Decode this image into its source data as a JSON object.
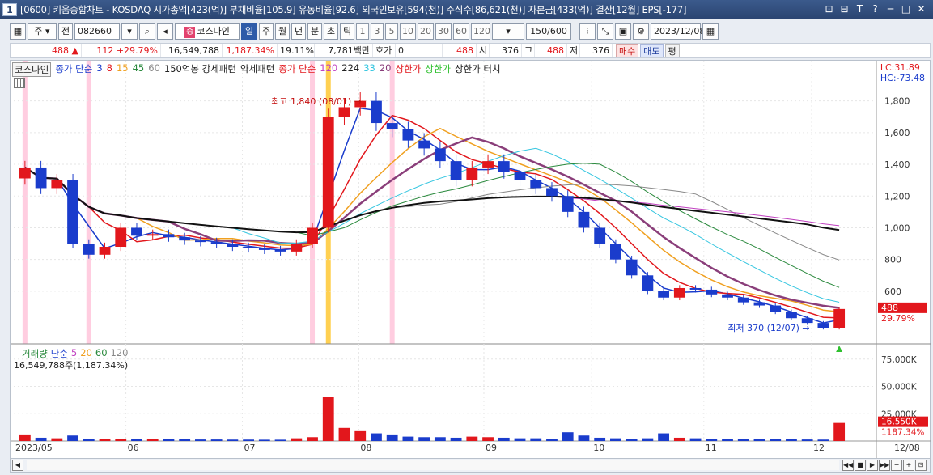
{
  "window": {
    "num": "1",
    "title": "[0600] 키움종합차트 - KOSDAQ 시가총액[423(억)] 부채비율[105.9] 유동비율[92.6] 외국인보유[594(천)] 주식수[86,621(천)] 자본금[433(억)] 결산[12월] EPS[-177]",
    "buttons": [
      "⊡",
      "⊟",
      "T",
      "?",
      "─",
      "□",
      "✕"
    ]
  },
  "toolbar": {
    "period": "주",
    "prev": "전",
    "code": "082660",
    "stock_badge": "증",
    "stock_name": "코스나인",
    "tabs": [
      "일",
      "주",
      "월",
      "년",
      "분",
      "초",
      "틱"
    ],
    "selected_tab": "일",
    "nums": [
      "1",
      "3",
      "5",
      "10",
      "20",
      "30",
      "60",
      "120"
    ],
    "count": "150/600",
    "date": "2023/12/08"
  },
  "info": {
    "price": "488",
    "change": "112",
    "change_pct": "+29.79%",
    "volume": "16,549,788",
    "volume_pct": "1,187.34%",
    "turnover": "19.11%",
    "amount": "7,781백만",
    "hoga_label": "호가",
    "hoga": "0",
    "p1": "488",
    "open_label": "시",
    "open": "376",
    "high_label": "고",
    "high": "488",
    "low_label": "저",
    "low": "376",
    "buy": "매수",
    "sell": "매도",
    "flat": "평"
  },
  "chart": {
    "legend": {
      "name": "코스나인",
      "ma_label": "종가 단순",
      "ma_periods": [
        "3",
        "8",
        "15",
        "45",
        "60"
      ],
      "pattern1": "150억봉 강세패턴",
      "pattern2": "약세패턴",
      "ma2_label": "종가 단순",
      "ma2_periods": [
        "120",
        "224",
        "33",
        "20"
      ],
      "limit_up": "상한가",
      "limit_up2": "상한가",
      "limit_touch": "상한가 터치"
    },
    "lc": "LC:31.89",
    "hc": "HC:-73.48",
    "max_label": "최고 1,840 (08/01)",
    "min_label": "최저 370 (12/07)",
    "price_tag": "488",
    "pct_tag": "29.79%",
    "vol_legend": {
      "label": "거래량",
      "ma_label": "단순",
      "periods": [
        "5",
        "20",
        "60",
        "120"
      ]
    },
    "vol_info": "16,549,788주(1,187.34%)",
    "vol_tag": "16,550K",
    "vol_pct_tag": "1187.34%",
    "x_months": [
      "2023/05",
      "06",
      "07",
      "08",
      "09",
      "10",
      "11",
      "12",
      "12/08"
    ]
  },
  "chart_data": {
    "type": "candlestick",
    "price_axis": {
      "ticks": [
        "1,800",
        "1,600",
        "1,400",
        "1,200",
        "1,000",
        "800",
        "600"
      ],
      "ylim": [
        370,
        1900
      ]
    },
    "volume_axis": {
      "ticks": [
        "75,000K",
        "50,000K",
        "25,000K"
      ],
      "ylim": [
        0,
        80000
      ]
    },
    "series": [
      {
        "name": "close",
        "values": [
          1380,
          1250,
          1300,
          900,
          830,
          880,
          1000,
          950,
          960,
          940,
          920,
          910,
          900,
          880,
          870,
          860,
          850,
          900,
          1000,
          1700,
          1760,
          1800,
          1660,
          1620,
          1550,
          1500,
          1420,
          1300,
          1380,
          1420,
          1350,
          1300,
          1250,
          1200,
          1100,
          1000,
          900,
          800,
          700,
          600,
          560,
          620,
          610,
          580,
          560,
          530,
          510,
          470,
          430,
          400,
          370,
          488
        ]
      }
    ],
    "highs": [
      {
        "label": "최고",
        "value": 1840,
        "date": "08/01"
      }
    ],
    "lows": [
      {
        "label": "최저",
        "value": 370,
        "date": "12/07"
      }
    ],
    "volume_values": [
      6000,
      3000,
      2500,
      5000,
      2000,
      2000,
      1800,
      1700,
      1600,
      1500,
      1500,
      1400,
      1400,
      1300,
      1300,
      1200,
      1200,
      2500,
      3500,
      40000,
      12000,
      9000,
      7000,
      6000,
      4000,
      3500,
      3500,
      3000,
      4000,
      3500,
      3000,
      2500,
      2500,
      2000,
      8000,
      5000,
      3000,
      2500,
      2000,
      2500,
      7000,
      3000,
      2500,
      2000,
      2000,
      1800,
      1700,
      1600,
      1500,
      1400,
      1300,
      16550
    ]
  }
}
